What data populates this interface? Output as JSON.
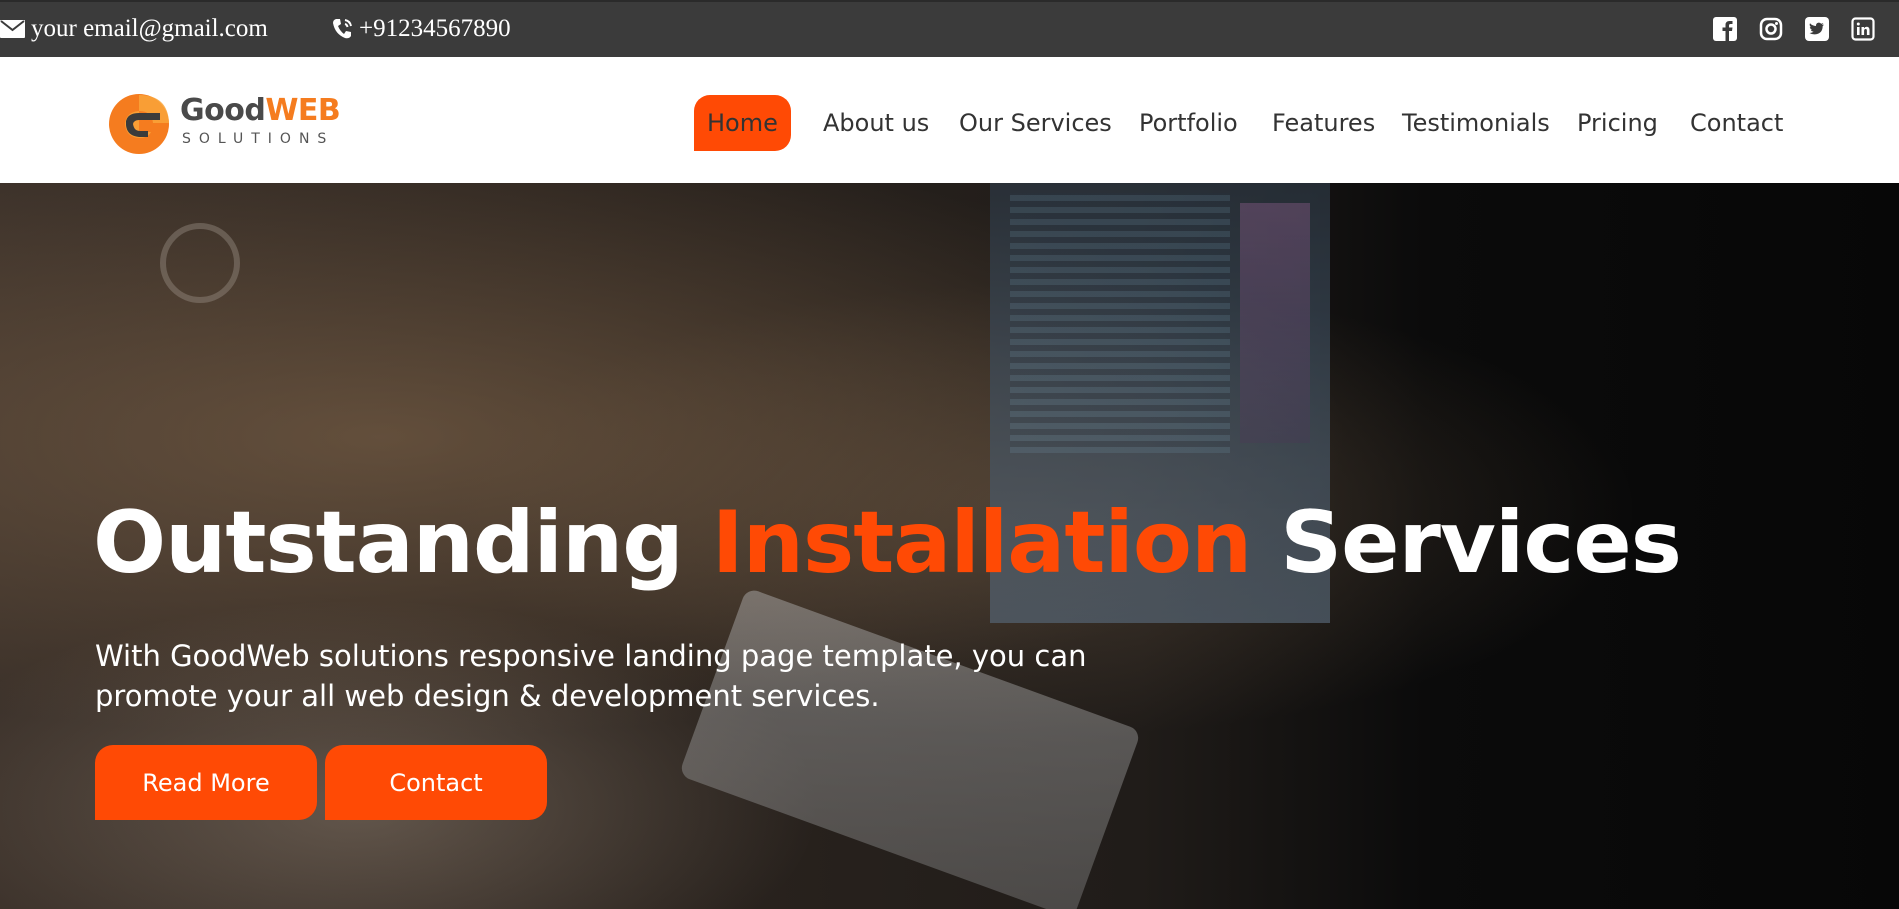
{
  "topbar": {
    "email": "your email@gmail.com",
    "phone": "+91234567890",
    "social": [
      "facebook-icon",
      "instagram-icon",
      "twitter-icon",
      "linkedin-icon"
    ]
  },
  "brand": {
    "name_part1": "Good",
    "name_part2": "WEB",
    "tagline": "SOLUTIONS"
  },
  "nav": {
    "items": [
      "Home",
      "About us",
      "Our Services",
      "Portfolio",
      "Features",
      "Testimonials",
      "Pricing",
      "Contact"
    ],
    "active": "Home"
  },
  "hero": {
    "title_part1": "Outstanding",
    "title_accent": "Installation",
    "title_part2": "Services",
    "lead": "With GoodWeb solutions responsive landing page template, you can promote your all web design & development services.",
    "primary_button": "Read More",
    "secondary_button": "Contact"
  },
  "colors": {
    "accent": "#ff4a05",
    "topbar": "#3b3b3b",
    "logo_orange": "#f57c1f"
  }
}
